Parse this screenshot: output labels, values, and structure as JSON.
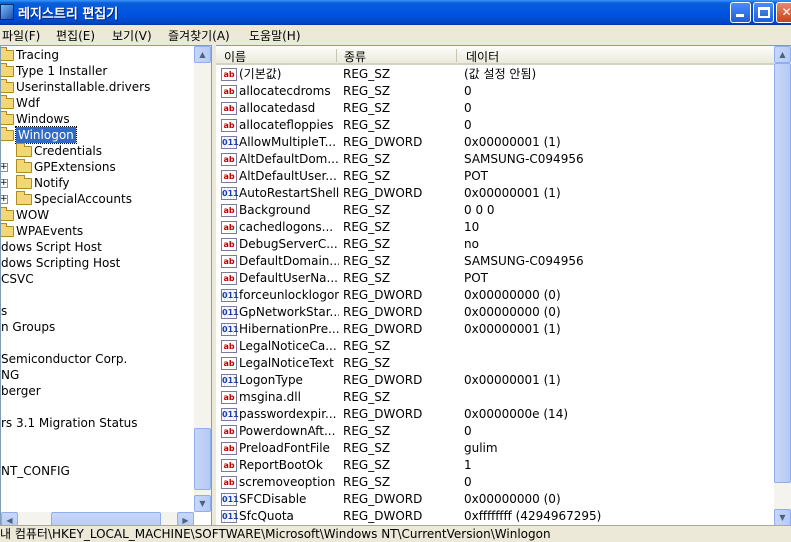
{
  "window": {
    "title": "레지스트리 편집기"
  },
  "menu": [
    {
      "label": "파일(F)"
    },
    {
      "label": "편집(E)"
    },
    {
      "label": "보기(V)"
    },
    {
      "label": "즐겨찾기(A)"
    },
    {
      "label": "도움말(H)"
    }
  ],
  "tree": [
    {
      "label": "Tracing",
      "selected": false
    },
    {
      "label": "Type 1 Installer",
      "selected": false
    },
    {
      "label": "Userinstallable.drivers",
      "selected": false
    },
    {
      "label": "Wdf",
      "selected": false
    },
    {
      "label": "Windows",
      "selected": false
    },
    {
      "label": "Winlogon",
      "selected": true
    },
    {
      "label": "Credentials",
      "selected": false
    },
    {
      "label": "GPExtensions",
      "selected": false
    },
    {
      "label": "Notify",
      "selected": false
    },
    {
      "label": "SpecialAccounts",
      "selected": false
    },
    {
      "label": "WOW",
      "selected": false
    },
    {
      "label": "WPAEvents",
      "selected": false
    },
    {
      "label": "dows Script Host",
      "selected": false
    },
    {
      "label": "dows Scripting Host",
      "selected": false
    },
    {
      "label": "CSVC",
      "selected": false
    },
    {
      "label": "",
      "selected": false
    },
    {
      "label": "s",
      "selected": false
    },
    {
      "label": "n Groups",
      "selected": false
    },
    {
      "label": "",
      "selected": false
    },
    {
      "label": " Semiconductor Corp.",
      "selected": false
    },
    {
      "label": "NG",
      "selected": false
    },
    {
      "label": "berger",
      "selected": false
    },
    {
      "label": "",
      "selected": false
    },
    {
      "label": "rs 3.1 Migration Status",
      "selected": false
    },
    {
      "label": "",
      "selected": false
    },
    {
      "label": "",
      "selected": false
    },
    {
      "label": "NT_CONFIG",
      "selected": false
    }
  ],
  "columns": {
    "name": "이름",
    "type": "종류",
    "data": "데이터"
  },
  "values": [
    {
      "icon": "sz",
      "name": "(기본값)",
      "type": "REG_SZ",
      "data": "(값 설정 안됨)"
    },
    {
      "icon": "sz",
      "name": "allocatecdroms",
      "type": "REG_SZ",
      "data": "0"
    },
    {
      "icon": "sz",
      "name": "allocatedasd",
      "type": "REG_SZ",
      "data": "0"
    },
    {
      "icon": "sz",
      "name": "allocatefloppies",
      "type": "REG_SZ",
      "data": "0"
    },
    {
      "icon": "dw",
      "name": "AllowMultipleT...",
      "type": "REG_DWORD",
      "data": "0x00000001 (1)"
    },
    {
      "icon": "sz",
      "name": "AltDefaultDom...",
      "type": "REG_SZ",
      "data": "SAMSUNG-C094956"
    },
    {
      "icon": "sz",
      "name": "AltDefaultUser...",
      "type": "REG_SZ",
      "data": "POT"
    },
    {
      "icon": "dw",
      "name": "AutoRestartShell",
      "type": "REG_DWORD",
      "data": "0x00000001 (1)"
    },
    {
      "icon": "sz",
      "name": "Background",
      "type": "REG_SZ",
      "data": "0 0 0"
    },
    {
      "icon": "sz",
      "name": "cachedlogons...",
      "type": "REG_SZ",
      "data": "10"
    },
    {
      "icon": "sz",
      "name": "DebugServerC...",
      "type": "REG_SZ",
      "data": "no"
    },
    {
      "icon": "sz",
      "name": "DefaultDomain...",
      "type": "REG_SZ",
      "data": "SAMSUNG-C094956"
    },
    {
      "icon": "sz",
      "name": "DefaultUserNa...",
      "type": "REG_SZ",
      "data": "POT"
    },
    {
      "icon": "dw",
      "name": "forceunlocklogon",
      "type": "REG_DWORD",
      "data": "0x00000000 (0)"
    },
    {
      "icon": "dw",
      "name": "GpNetworkStar...",
      "type": "REG_DWORD",
      "data": "0x00000000 (0)"
    },
    {
      "icon": "dw",
      "name": "HibernationPre...",
      "type": "REG_DWORD",
      "data": "0x00000001 (1)"
    },
    {
      "icon": "sz",
      "name": "LegalNoticeCa...",
      "type": "REG_SZ",
      "data": ""
    },
    {
      "icon": "sz",
      "name": "LegalNoticeText",
      "type": "REG_SZ",
      "data": ""
    },
    {
      "icon": "dw",
      "name": "LogonType",
      "type": "REG_DWORD",
      "data": "0x00000001 (1)"
    },
    {
      "icon": "sz",
      "name": "msgina.dll",
      "type": "REG_SZ",
      "data": ""
    },
    {
      "icon": "dw",
      "name": "passwordexpir...",
      "type": "REG_DWORD",
      "data": "0x0000000e (14)"
    },
    {
      "icon": "sz",
      "name": "PowerdownAft...",
      "type": "REG_SZ",
      "data": "0"
    },
    {
      "icon": "sz",
      "name": "PreloadFontFile",
      "type": "REG_SZ",
      "data": "gulim"
    },
    {
      "icon": "sz",
      "name": "ReportBootOk",
      "type": "REG_SZ",
      "data": "1"
    },
    {
      "icon": "sz",
      "name": "scremoveoption",
      "type": "REG_SZ",
      "data": "0"
    },
    {
      "icon": "dw",
      "name": "SFCDisable",
      "type": "REG_DWORD",
      "data": "0x00000000 (0)"
    },
    {
      "icon": "dw",
      "name": "SfcQuota",
      "type": "REG_DWORD",
      "data": "0xffffffff (4294967295)"
    }
  ],
  "status": {
    "path": "내 컴퓨터\\HKEY_LOCAL_MACHINE\\SOFTWARE\\Microsoft\\Windows NT\\CurrentVersion\\Winlogon"
  },
  "icons": {
    "string_value": "ab",
    "binary_value": "011"
  }
}
